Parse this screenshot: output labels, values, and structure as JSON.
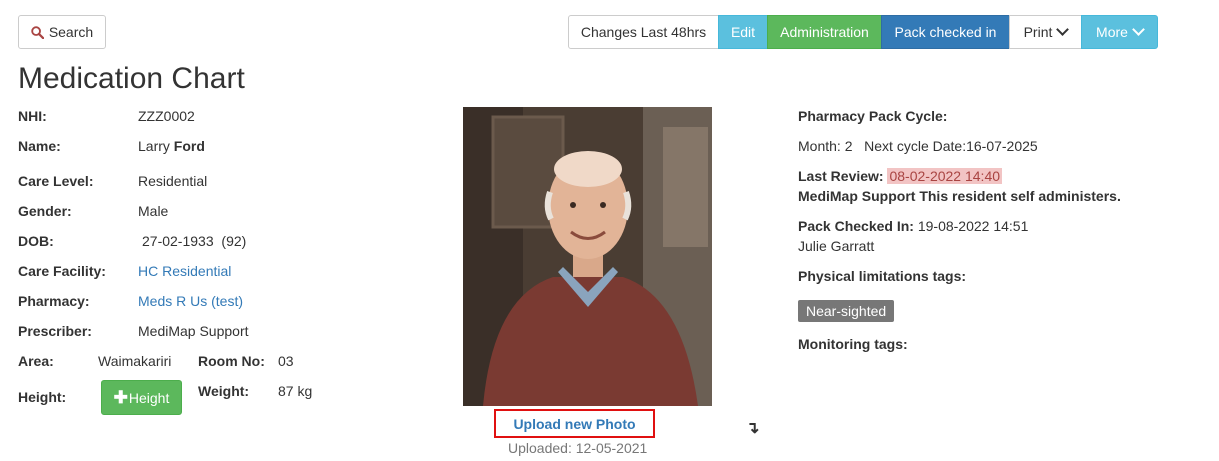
{
  "toolbar": {
    "search_label": "Search",
    "changes_label": "Changes Last 48hrs",
    "edit_label": "Edit",
    "admin_label": "Administration",
    "pack_label": "Pack checked in",
    "print_label": "Print",
    "more_label": "More"
  },
  "page": {
    "title": "Medication Chart"
  },
  "patient": {
    "nhi_label": "NHI:",
    "nhi": "ZZZ0002",
    "name_label": "Name:",
    "first_name": "Larry",
    "last_name": "Ford",
    "care_level_label": "Care Level:",
    "care_level": "Residential",
    "gender_label": "Gender:",
    "gender": "Male",
    "dob_label": "DOB:",
    "dob": "27-02-1933",
    "age": "(92)",
    "facility_label": "Care Facility:",
    "facility": "HC Residential",
    "pharmacy_label": "Pharmacy:",
    "pharmacy": "Meds R Us (test)",
    "prescriber_label": "Prescriber:",
    "prescriber": "MediMap Support",
    "area_label": "Area:",
    "area": "Waimakariri",
    "room_label": "Room No:",
    "room": "03",
    "height_label": "Height:",
    "height_button": "Height",
    "weight_label": "Weight:",
    "weight": "87 kg"
  },
  "photo": {
    "upload_label": "Upload new Photo",
    "uploaded_text": "Uploaded: 12-05-2021"
  },
  "pharmacy_pack": {
    "cycle_label": "Pharmacy Pack Cycle:",
    "month_text": "Month: 2",
    "next_cycle_text": "Next cycle Date:16-07-2025",
    "last_review_label": "Last Review:",
    "last_review_date": "08-02-2022 14:40",
    "review_note": "MediMap Support This resident self administers.",
    "checked_in_label": "Pack Checked In:",
    "checked_in_date": "19-08-2022 14:51",
    "checked_in_by": "Julie Garratt",
    "physical_tags_label": "Physical limitations tags:",
    "physical_tags": [
      "Near-sighted"
    ],
    "monitoring_tags_label": "Monitoring tags:"
  },
  "colors": {
    "edit": "#5bc0de",
    "admin": "#5cb85c",
    "pack": "#337ab7",
    "more": "#5bc0de",
    "highlight": "#e01010",
    "link": "#337ab7"
  }
}
